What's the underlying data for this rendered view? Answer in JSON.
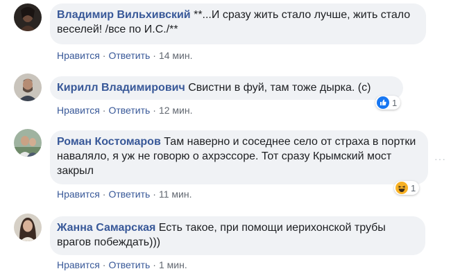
{
  "comments": [
    {
      "author": "Владимир Вильхивский",
      "text": " **...И сразу жить стало лучше, жить стало веселей! /все по И.С./**",
      "like_label": "Нравится",
      "reply_label": "Ответить",
      "time": "14 мин."
    },
    {
      "author": "Кирилл Владимирович",
      "text": " Свистни в фуй, там тоже дырка. (с)",
      "like_label": "Нравится",
      "reply_label": "Ответить",
      "time": "12 мин.",
      "reaction": {
        "icon": "like-icon",
        "count": "1",
        "color": "#1877f2"
      }
    },
    {
      "author": "Роман Костомаров",
      "text": " Там наверно и соседнее село от страха в портки наваляло, я уж не говорю о ахрэссоре. Тот сразу Крымский мост закрыл",
      "like_label": "Нравится",
      "reply_label": "Ответить",
      "time": "11 мин.",
      "reaction": {
        "icon": "haha-icon",
        "count": "1",
        "color": "#f7b125"
      }
    },
    {
      "author": "Жанна Самарская",
      "text": " Есть такое, при помощи иерихонской трубы врагов побеждать)))",
      "like_label": "Нравится",
      "reply_label": "Ответить",
      "time": "1 мин."
    }
  ],
  "separator": "·",
  "more_glyph": "···",
  "colors": {
    "bubble": "#f0f2f5",
    "author": "#385898",
    "meta": "#616770"
  }
}
